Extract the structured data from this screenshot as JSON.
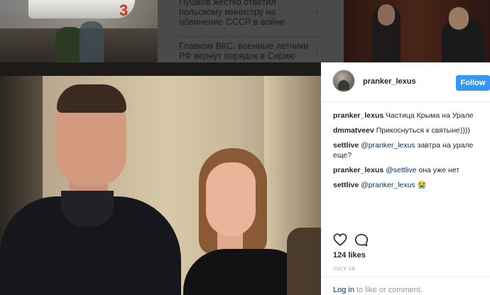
{
  "news": {
    "items": [
      {
        "title": "Пушков жестко ответил польскому министру на обвинение СССР в войне"
      },
      {
        "title": "Главком ВКС: военные летчики РФ вернут порядок в Сирию"
      }
    ],
    "chevron": "›"
  },
  "post": {
    "username": "pranker_lexus",
    "follow_label": "Follow",
    "comments": [
      {
        "user": "pranker_lexus",
        "text": "Частица Крыма на Урале"
      },
      {
        "user": "dmmatveev",
        "text": "Прикоснуться к святыне))))"
      },
      {
        "user": "settlive",
        "mention": "@pranker_lexus",
        "text": "завтра на урале еще?"
      },
      {
        "user": "pranker_lexus",
        "mention": "@settlive",
        "text": "она уже нет"
      },
      {
        "user": "settlive",
        "mention": "@pranker_lexus",
        "text": "😭"
      }
    ],
    "likes": "124 likes",
    "date": "JULY 19",
    "login_link": "Log in",
    "login_rest": " to like or comment."
  },
  "icons": {
    "heart": "heart-icon",
    "comment": "comment-icon"
  },
  "colors": {
    "follow_bg": "#3897f0",
    "link": "#003569"
  }
}
